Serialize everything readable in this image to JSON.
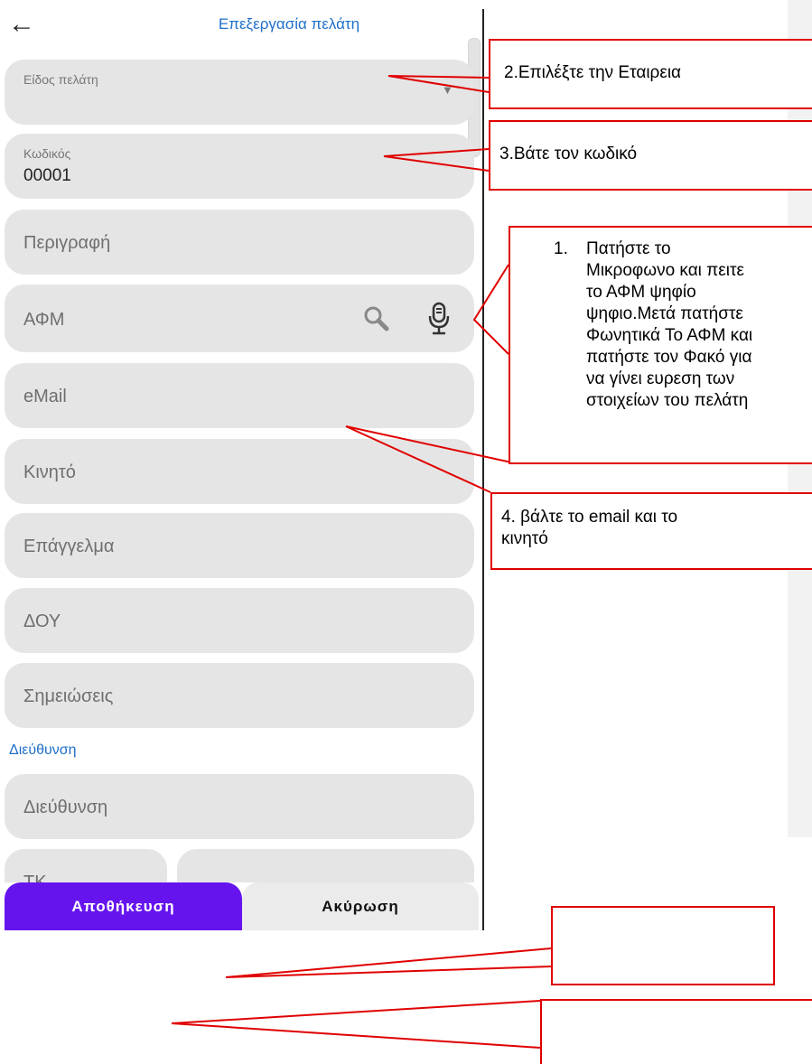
{
  "header": {
    "back_icon": "arrow-left-icon",
    "title": "Επεξεργασία πελάτη"
  },
  "form": {
    "customer_type": {
      "label": "Είδος πελάτη",
      "selected": ""
    },
    "code": {
      "label": "Κωδικός",
      "value": "00001"
    },
    "description": {
      "placeholder": "Περιγραφή"
    },
    "vat": {
      "placeholder": "ΑΦΜ",
      "icons": [
        "search-icon",
        "microphone-icon"
      ]
    },
    "email": {
      "placeholder": "eMail"
    },
    "mobile": {
      "placeholder": "Κινητό"
    },
    "profession": {
      "placeholder": "Επάγγελμα"
    },
    "tax_office": {
      "placeholder": "ΔΟΥ"
    },
    "notes": {
      "placeholder": "Σημειώσεις"
    },
    "address_section": "Διεύθυνση",
    "address": {
      "placeholder": "Διεύθυνση"
    },
    "postal_code": {
      "placeholder": "ΤΚ"
    }
  },
  "buttons": {
    "save": "Αποθήκευση",
    "cancel": "Ακύρωση"
  },
  "callouts": {
    "select_company": "2.Επιλέξτε την Εταιρεια",
    "enter_code": "3.Βάτε τον κωδικό",
    "voice_vat": [
      "Πατήστε το",
      "Μικροφωνο και πειτε",
      "το ΑΦΜ ψηφίο",
      "ψηφιο.Μετά πατήστε",
      "Φωνητικά Το ΑΦΜ και",
      "πατήστε τον Φακό για",
      "να γίνει ευρεση των",
      "στοιχείων του πελάτη"
    ],
    "voice_vat_number": "1.",
    "email_mobile_line1": "4. βάλτε το email και το",
    "email_mobile_line2": "κινητό",
    "blank_save": "",
    "blank_cancel": ""
  },
  "colors": {
    "accent_blue": "#1e6fc9",
    "save_purple": "#6614ee",
    "callout_red": "#e00000",
    "field_gray": "#e5e5e5"
  }
}
